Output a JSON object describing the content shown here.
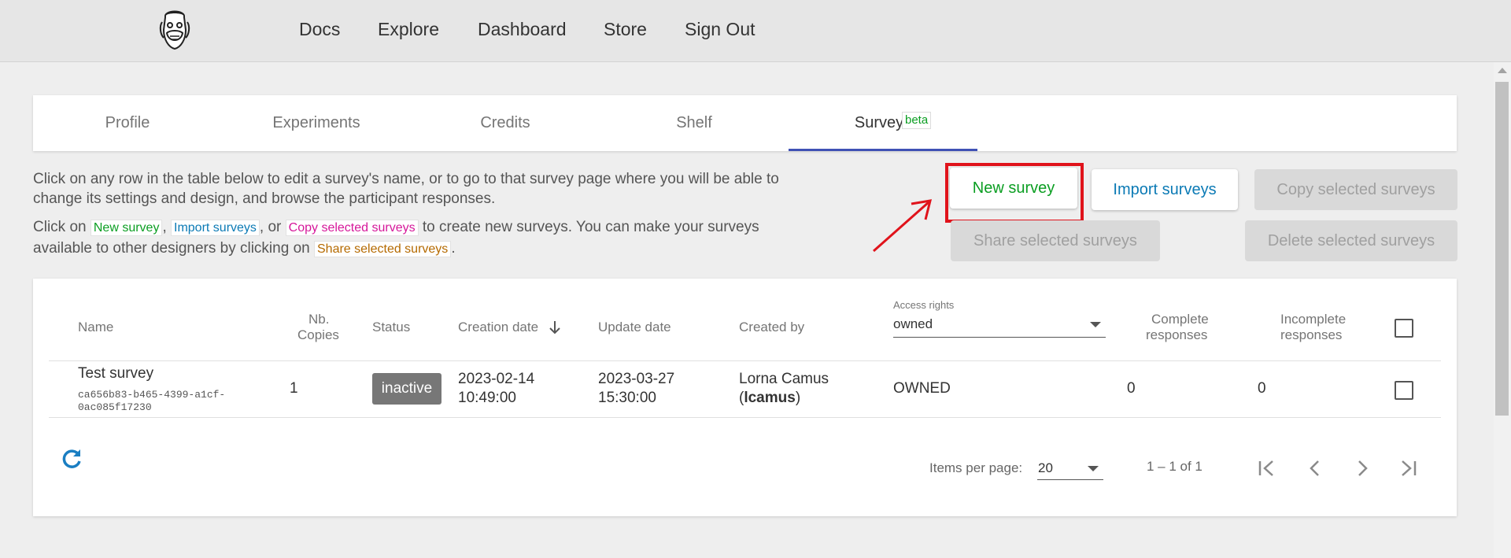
{
  "nav": {
    "items": [
      "Docs",
      "Explore",
      "Dashboard",
      "Store",
      "Sign Out"
    ]
  },
  "tabs": {
    "items": [
      "Profile",
      "Experiments",
      "Credits",
      "Shelf",
      "Surveys"
    ],
    "active": "Surveys",
    "badge": "beta"
  },
  "description": {
    "line1": "Click on any row in the table below to edit a survey's name, or to go to that survey page where you will be able to",
    "line2": "change its settings and design, and browse the participant responses.",
    "line3_prefix": "Click on",
    "line3_mid1": ",",
    "line3_mid2": ", or",
    "line3_suffix": "to create new surveys. You can make your surveys",
    "line4_prefix": "available to other designers by clicking on",
    "line4_suffix": ".",
    "chip_new": "New survey",
    "chip_import": "Import surveys",
    "chip_copy": "Copy selected surveys",
    "chip_share": "Share selected surveys"
  },
  "buttons": {
    "new_survey": "New survey",
    "import_surveys": "Import surveys",
    "copy_selected": "Copy selected surveys",
    "share_selected": "Share selected surveys",
    "delete_selected": "Delete selected surveys"
  },
  "table": {
    "headers": {
      "name": "Name",
      "copies_l1": "Nb.",
      "copies_l2": "Copies",
      "status": "Status",
      "creation": "Creation date",
      "update": "Update date",
      "created_by": "Created by",
      "access_label": "Access rights",
      "access_value": "owned",
      "complete_l1": "Complete",
      "complete_l2": "responses",
      "incomplete_l1": "Incomplete",
      "incomplete_l2": "responses"
    },
    "rows": [
      {
        "name": "Test survey",
        "id_l1": "ca656b83-b465-4399-a1cf-",
        "id_l2": "0ac085f17230",
        "copies": "1",
        "status": "inactive",
        "creation_l1": "2023-02-14",
        "creation_l2": "10:49:00",
        "update_l1": "2023-03-27",
        "update_l2": "15:30:00",
        "creator_name": "Lorna Camus",
        "creator_user_open": "(",
        "creator_user": "lcamus",
        "creator_user_close": ")",
        "access": "OWNED",
        "complete": "0",
        "incomplete": "0"
      }
    ]
  },
  "pagination": {
    "items_per_page_label": "Items per page:",
    "items_per_page_value": "20",
    "range": "1 – 1 of 1"
  },
  "colors": {
    "accent_tab": "#3f51b5",
    "green": "#0b9e22",
    "blue": "#0b7ab5",
    "annotation_red": "#e0131b"
  }
}
